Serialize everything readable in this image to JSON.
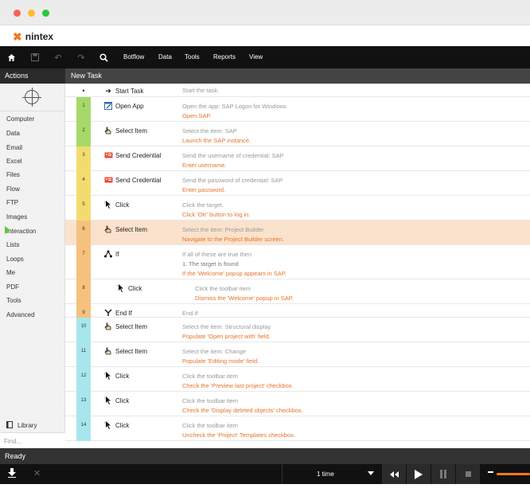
{
  "window": {
    "traffic_lights": [
      "#fe5f57",
      "#febc2e",
      "#28c840"
    ]
  },
  "brand": {
    "name": "nintex",
    "accent": "#f47920"
  },
  "toolbar": {
    "icons": [
      "home-icon",
      "save-icon",
      "undo-icon",
      "redo-icon",
      "search-icon"
    ],
    "menus": [
      "Botflow",
      "Data",
      "Tools",
      "Reports",
      "View"
    ]
  },
  "actions_panel": {
    "title": "Actions",
    "categories": [
      "Computer",
      "Data",
      "Email",
      "Excel",
      "Files",
      "Flow",
      "FTP",
      "Images",
      "Interaction",
      "Lists",
      "Loops",
      "Me",
      "PDF",
      "Tools",
      "Advanced"
    ],
    "library": "Library",
    "find_placeholder": "Find..."
  },
  "task": {
    "title": "New Task",
    "start": {
      "bullet": "•",
      "action": "Start Task",
      "desc": "Start the task."
    },
    "steps": [
      {
        "num": "1",
        "action": "Open App",
        "icon": "open-app-icon",
        "desc": "Open the app: SAP Logon for Windows",
        "comment": "Open SAP.",
        "color": "#a6d96a"
      },
      {
        "num": "2",
        "action": "Select Item",
        "icon": "hand-icon",
        "desc": "Select the item: SAP",
        "comment": "Launch the SAP instance.",
        "color": "#a6d96a"
      },
      {
        "num": "3",
        "action": "Send Credential",
        "icon": "credential-icon",
        "desc": "Send the username of credential: SAP",
        "comment": "Enter username.",
        "color": "#f3dc6f"
      },
      {
        "num": "4",
        "action": "Send Credential",
        "icon": "credential-icon",
        "desc": "Send the password of credential: SAP",
        "comment": "Enter password.",
        "color": "#f3dc6f"
      },
      {
        "num": "5",
        "action": "Click",
        "icon": "cursor-icon",
        "desc": "Click the target.",
        "comment": "Click 'OK' button to log in.",
        "color": "#f3dc6f"
      },
      {
        "num": "6",
        "action": "Select Item",
        "icon": "hand-icon",
        "desc": "Select the item: Project Builder",
        "comment": "Navigate to the Project Builder screen.",
        "color": "#f5c27d"
      },
      {
        "num": "7",
        "action": "If",
        "icon": "if-icon",
        "desc": "If all of these are true then",
        "desc2": "1. The target is found",
        "comment": "If the 'Welcome' popup appears in SAP.",
        "color": "#f5c27d"
      },
      {
        "num": "8",
        "action": "Click",
        "icon": "cursor-icon",
        "desc": "Click the toolbar item",
        "comment": "Dismiss the 'Welcome' popup in SAP.",
        "color": "#f5c27d"
      },
      {
        "num": "9",
        "action": "End If",
        "icon": "endif-icon",
        "desc": "End If",
        "comment": "",
        "color": "#f5c27d"
      },
      {
        "num": "10",
        "action": "Select Item",
        "icon": "hand-icon",
        "desc": "Select the item: Structural display",
        "comment": "Populate 'Open project with' field.",
        "color": "#a8e6ee"
      },
      {
        "num": "11",
        "action": "Select Item",
        "icon": "hand-icon",
        "desc": "Select the item: Change",
        "comment": "Populate 'Editing mode' field.",
        "color": "#a8e6ee"
      },
      {
        "num": "12",
        "action": "Click",
        "icon": "cursor-icon",
        "desc": "Click the toolbar item",
        "comment": "Check the 'Preview last project' checkbox.",
        "color": "#a8e6ee"
      },
      {
        "num": "13",
        "action": "Click",
        "icon": "cursor-icon",
        "desc": "Click the toolbar item",
        "comment": "Check the 'Display deleted objects' checkbox.",
        "color": "#a8e6ee"
      },
      {
        "num": "14",
        "action": "Click",
        "icon": "cursor-icon",
        "desc": "Click the toolbar item",
        "comment": "Uncheck the 'Project' Templates checkbox.",
        "color": "#a8e6ee"
      }
    ],
    "current_step": "6"
  },
  "status": {
    "text": "Ready"
  },
  "run": {
    "repeat": "1 time"
  }
}
